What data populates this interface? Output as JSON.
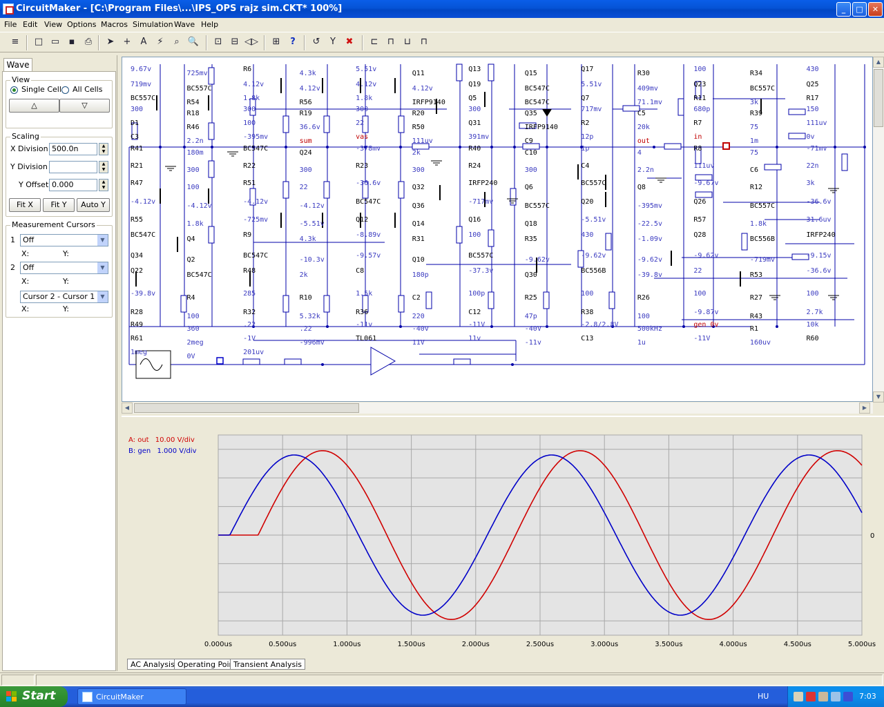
{
  "window": {
    "title": "CircuitMaker - [C:\\Program Files\\...\\IPS_OPS rajz sim.CKT* 100%]",
    "controls": {
      "minimize": "_",
      "maximize": "□",
      "close": "✕"
    }
  },
  "menu": [
    "File",
    "Edit",
    "View",
    "Options",
    "Macros",
    "Simulation",
    "Wave",
    "Help"
  ],
  "toolbar": {
    "icons": [
      "wire-mode-icon",
      "new-file-icon",
      "open-folder-icon",
      "save-disk-icon",
      "print-icon",
      "arrow-pointer-icon",
      "crosshair-icon",
      "text-tool-icon",
      "probe-icon",
      "zoom-probe-icon",
      "magnifier-icon",
      "zoom-fit-icon",
      "rotate-icon",
      "mirror-icon",
      "netlist-icon",
      "help-question-icon",
      "reset-icon",
      "tweezers-icon",
      "stop-sim-icon",
      "digital-sim-icon",
      "analog-sim-icon",
      "wave-view-icon",
      "trace-icon"
    ],
    "glyphs": [
      "≡",
      "□",
      "▭",
      "▪",
      "⎙",
      "➤",
      "+",
      "A",
      "⚡",
      "⌕",
      "🔍",
      "⊡",
      "⊟",
      "◁▷",
      "⊞",
      "?",
      "↺",
      "Y",
      "✖",
      "⊏",
      "⊓",
      "⊔",
      "⊓"
    ]
  },
  "left_panel": {
    "tab": "Wave",
    "view": {
      "title": "View",
      "single_cell": "Single Cell",
      "all_cells": "All Cells",
      "selected": "Single Cell"
    },
    "nav": {
      "up": "△",
      "down": "▽"
    },
    "scaling": {
      "title": "Scaling",
      "x_division_label": "X Division",
      "x_division_value": "500.0n",
      "y_division_label": "Y Division",
      "y_division_value": "",
      "y_offset_label": "Y Offset",
      "y_offset_value": "0.000",
      "fit_x": "Fit X",
      "fit_y": "Fit Y",
      "auto_y": "Auto Y"
    },
    "cursors": {
      "title": "Measurement Cursors",
      "c1_num": "1",
      "c1_value": "Off",
      "c1_x": "X:",
      "c1_y": "Y:",
      "c2_num": "2",
      "c2_value": "Off",
      "c2_x": "X:",
      "c2_y": "Y:",
      "diff_value": "Cursor 2 - Cursor 1",
      "diff_x": "X:",
      "diff_y": "Y:"
    }
  },
  "schematic": {
    "wire_color": "#0000a8",
    "label_color": "#3a3ac0",
    "node_color": "#c00000",
    "labels": [
      "9.67v",
      "725mv",
      "R6",
      "4.3k",
      "5.51v",
      "Q11",
      "Q13",
      "Q15",
      "Q17",
      "R30",
      "100",
      "R34",
      "430",
      "719mv",
      "BC557C",
      "4.12v",
      "4.12v",
      "4.12v",
      "4.12v",
      "Q19",
      "BC547C",
      "5.51v",
      "409mv",
      "Q23",
      "BC557C",
      "Q25",
      "BC557C",
      "R54",
      "1.8k",
      "R56",
      "1.8k",
      "IRFP9140",
      "Q5",
      "BC547C",
      "Q7",
      "71.1mv",
      "R11",
      "3k",
      "R17",
      "300",
      "R18",
      "300",
      "R19",
      "300",
      "R20",
      "300",
      "Q35",
      "717mv",
      "C5",
      "680p",
      "R39",
      "150",
      "D1",
      "R46",
      "100",
      "36.6v",
      "22",
      "R50",
      "Q31",
      "IRFP9140",
      "R2",
      "20k",
      "R7",
      "75",
      "111uv",
      "C3",
      "2.2n",
      "-395mv",
      "sum",
      "vas",
      "111uv",
      "391mv",
      "C9",
      "12p",
      "out",
      "in",
      "1m",
      "0v",
      "R41",
      "180m",
      "BC547C",
      "Q24",
      "-378mv",
      "2k",
      "R40",
      "C10",
      "1p",
      "4",
      "R8",
      "75",
      "-71mv",
      "R21",
      "300",
      "R22",
      "300",
      "R23",
      "300",
      "R24",
      "300",
      "C4",
      "2.2n",
      "111uv",
      "C6",
      "22n",
      "R47",
      "100",
      "R51",
      "22",
      "-36.6v",
      "Q32",
      "IRFP240",
      "Q6",
      "BC557C",
      "Q8",
      "-9.67v",
      "R12",
      "3k",
      "-4.12v",
      "-4.12v",
      "-4.12v",
      "-4.12v",
      "BC547C",
      "Q36",
      "-717mv",
      "BC557C",
      "Q20",
      "-395mv",
      "Q26",
      "BC557C",
      "-36.6v",
      "R55",
      "1.8k",
      "-725mv",
      "-5.51v",
      "Q12",
      "Q14",
      "Q16",
      "Q18",
      "-5.51v",
      "-22.5v",
      "R57",
      "1.8k",
      "31.6uv",
      "BC547C",
      "Q4",
      "R9",
      "4.3k",
      "-8.89v",
      "R31",
      "100",
      "R35",
      "430",
      "-1.09v",
      "Q28",
      "BC556B",
      "IRFP240",
      "Q34",
      "Q2",
      "BC547C",
      "-10.3v",
      "-9.57v",
      "Q10",
      "BC557C",
      "-9.62v",
      "-9.62v",
      "-9.62v",
      "-9.62v",
      "-719mv",
      "-9.15v",
      "Q22",
      "BC547C",
      "R48",
      "2k",
      "C8",
      "180p",
      "-37.3v",
      "Q30",
      "BC556B",
      "-39.8v",
      "22",
      "R53",
      "-36.6v",
      "-39.8v",
      "R4",
      "285",
      "R10",
      "1.5k",
      "C2",
      "100p",
      "R25",
      "100",
      "R26",
      "100",
      "R27",
      "100",
      "R28",
      "100",
      "R32",
      "5.32k",
      "R36",
      "220",
      "C12",
      "47p",
      "R38",
      "100",
      "-9.87v",
      "R43",
      "2.7k",
      "R49",
      "360",
      ".22",
      ".22",
      "-11v",
      "-40v",
      "-11V",
      "-40V",
      "-2.8/2.8V",
      "500kHz",
      "gen 0v",
      "R1",
      "10k",
      "R61",
      "2meg",
      "-1V",
      "-996mv",
      "TL061",
      "11V",
      "11v",
      "-11v",
      "C13",
      "1u",
      "-11V",
      "160uv",
      "R60",
      "1meg",
      "0V",
      "201uv"
    ]
  },
  "wave": {
    "legend_a": {
      "label": "A: out",
      "scale": "10.00 V/div",
      "color": "#d00000"
    },
    "legend_b": {
      "label": "B: gen",
      "scale": "1.000 V/div",
      "color": "#0000c8"
    },
    "zero_label": "0",
    "chart_data": {
      "type": "line",
      "x_ticks": [
        "0.000us",
        "0.500us",
        "1.000us",
        "1.500us",
        "2.000us",
        "2.500us",
        "3.000us",
        "3.500us",
        "4.000us",
        "4.500us",
        "5.000us"
      ],
      "xlim": [
        0,
        5
      ],
      "ylim_div": [
        -3.5,
        3.5
      ],
      "grid": true,
      "series": [
        {
          "name": "A: out",
          "color": "#d00000",
          "freq_mhz": 0.5,
          "start_us": 0.1,
          "delay_us": 0.21,
          "amplitude_div": 2.95
        },
        {
          "name": "B: gen",
          "color": "#0000c8",
          "freq_mhz": 0.5,
          "start_us": 0.09,
          "delay_us": 0.0,
          "amplitude_div": 2.8
        }
      ]
    }
  },
  "bottom_tabs": [
    "AC Analysis",
    "Operating Point",
    "Transient Analysis"
  ],
  "taskbar": {
    "start": "Start",
    "task": "CircuitMaker",
    "lang": "HU",
    "clock": "7:03"
  }
}
